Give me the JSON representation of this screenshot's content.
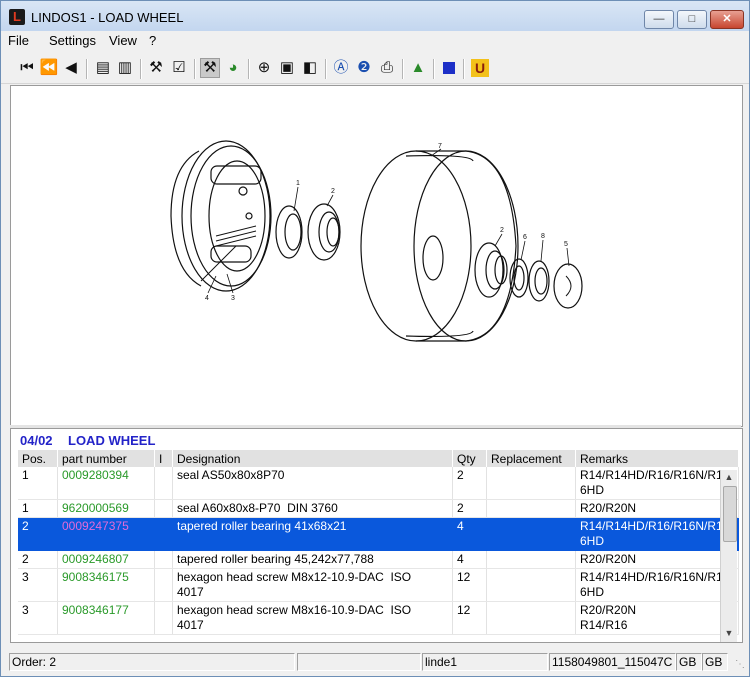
{
  "window": {
    "title": "LINDOS1 - LOAD WHEEL",
    "icon_letter": "L"
  },
  "menu": [
    "File",
    "Settings",
    "View",
    "?"
  ],
  "toolbar_icons": [
    "first-icon",
    "prev-page-icon",
    "prev-icon",
    "doc-back-icon",
    "doc-forward-icon",
    "cart-icon",
    "checklist-icon",
    "wrench-icon",
    "globe-icon",
    "zoom-icon",
    "fit-page-icon",
    "fit-width-icon",
    "search-a-icon",
    "search-2-icon",
    "print-icon",
    "export-icon",
    "color-icon",
    "u-icon"
  ],
  "parts_list": {
    "group_code": "04/02",
    "group_name": "LOAD WHEEL",
    "columns": [
      "Pos.",
      "part number",
      "I",
      "Designation",
      "Qty",
      "Replacement",
      "Remarks"
    ],
    "rows": [
      {
        "pos": "1",
        "part_number": "0009280394",
        "i": "",
        "designation": "seal AS50x80x8P70",
        "qty": "2",
        "replacement": "",
        "remarks": "R14/R14HD/R16/R16N/R1\n6HD"
      },
      {
        "pos": "1",
        "part_number": "9620000569",
        "i": "",
        "designation": "seal A60x80x8-P70  DIN 3760",
        "qty": "2",
        "replacement": "",
        "remarks": "R20/R20N"
      },
      {
        "pos": "2",
        "part_number": "0009247375",
        "i": "",
        "designation": "tapered roller bearing 41x68x21",
        "qty": "4",
        "replacement": "",
        "remarks": "R14/R14HD/R16/R16N/R1\n6HD",
        "selected": true
      },
      {
        "pos": "2",
        "part_number": "0009246807",
        "i": "",
        "designation": "tapered roller bearing 45,242x77,788",
        "qty": "4",
        "replacement": "",
        "remarks": "R20/R20N"
      },
      {
        "pos": "3",
        "part_number": "9008346175",
        "i": "",
        "designation": "hexagon head screw M8x12-10.9-DAC  ISO\n4017",
        "qty": "12",
        "replacement": "",
        "remarks": "R14/R14HD/R16/R16N/R1\n6HD"
      },
      {
        "pos": "3",
        "part_number": "9008346177",
        "i": "",
        "designation": "hexagon head screw M8x16-10.9-DAC  ISO\n4017",
        "qty": "12",
        "replacement": "",
        "remarks": "R20/R20N\nR14/R16"
      }
    ]
  },
  "drawing_labels": [
    "1",
    "2",
    "4",
    "3",
    "7",
    "2",
    "6",
    "8",
    "5"
  ],
  "status": {
    "order": "Order: 2",
    "field2": "",
    "user": "linde1",
    "code": "1158049801_115047C",
    "lang1": "GB",
    "lang2": "GB"
  }
}
